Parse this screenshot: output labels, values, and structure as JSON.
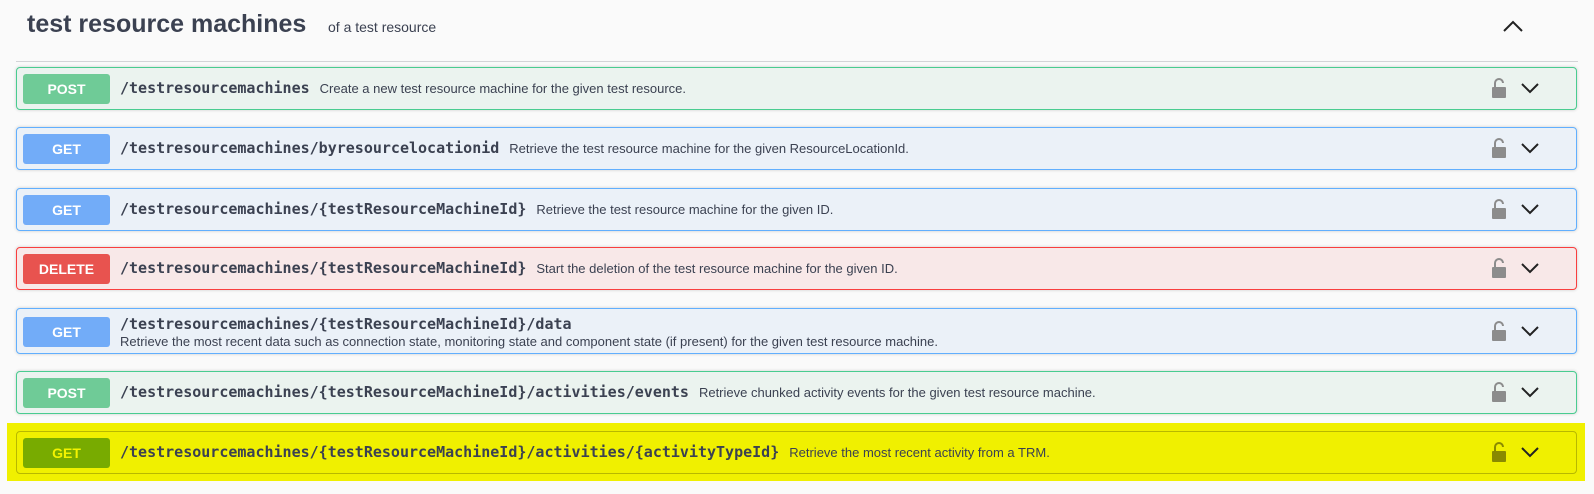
{
  "tag": {
    "title": "test resource machines",
    "description": "of a test resource"
  },
  "operations": [
    {
      "method": "POST",
      "path": "/testresourcemachines",
      "summary": "Create a new test resource machine for the given test resource."
    },
    {
      "method": "GET",
      "path": "/testresourcemachines/byresourcelocationid",
      "summary": "Retrieve the test resource machine for the given ResourceLocationId."
    },
    {
      "method": "GET",
      "path": "/testresourcemachines/{testResourceMachineId}",
      "summary": "Retrieve the test resource machine for the given ID."
    },
    {
      "method": "DELETE",
      "path": "/testresourcemachines/{testResourceMachineId}",
      "summary": "Start the deletion of the test resource machine for the given ID."
    },
    {
      "method": "GET",
      "path": "/testresourcemachines/{testResourceMachineId}/data",
      "summary": "Retrieve the most recent data such as connection state, monitoring state and component state (if present) for the given test resource machine."
    },
    {
      "method": "POST",
      "path": "/testresourcemachines/{testResourceMachineId}/activities/events",
      "summary": "Retrieve chunked activity events for the given test resource machine."
    },
    {
      "method": "GET",
      "path": "/testresourcemachines/{testResourceMachineId}/activities/{activityTypeId}",
      "summary": "Retrieve the most recent activity from a TRM."
    }
  ],
  "icons": {
    "collapse": "chevron-up-icon",
    "expand": "chevron-down-icon",
    "lock": "lock-open-icon"
  },
  "colors": {
    "post": "#49cc90",
    "get": "#61affe",
    "delete": "#f93e3e",
    "highlight": "#f0f000"
  }
}
